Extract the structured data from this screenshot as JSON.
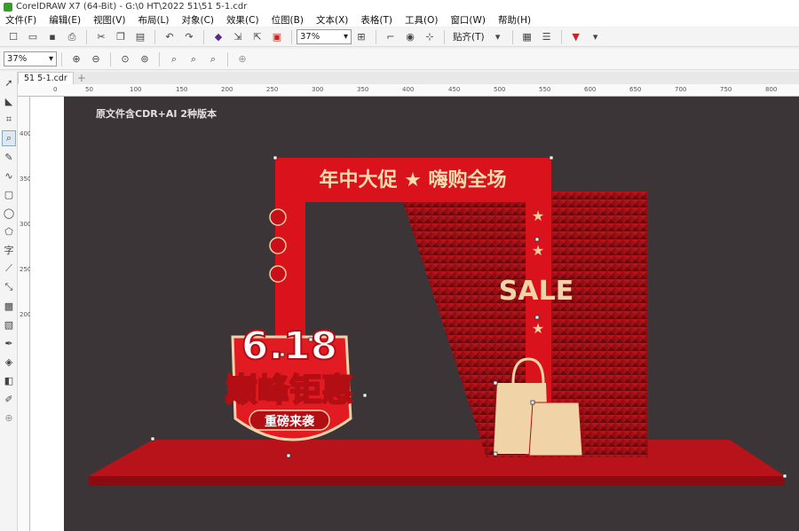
{
  "window": {
    "title": "CorelDRAW X7 (64-Bit) - G:\\0 HT\\2022 51\\51 5-1.cdr"
  },
  "menu": [
    "文件(F)",
    "编辑(E)",
    "视图(V)",
    "布局(L)",
    "对象(C)",
    "效果(C)",
    "位图(B)",
    "文本(X)",
    "表格(T)",
    "工具(O)",
    "窗口(W)",
    "帮助(H)"
  ],
  "toolbar": {
    "zoom_value": "37%",
    "snap_label": "贴齐(T)"
  },
  "propbar": {
    "zoom_value": "37%"
  },
  "tabs": [
    {
      "label": "51 5-1.cdr"
    }
  ],
  "ruler": {
    "h_ticks": [
      "0",
      "50",
      "100",
      "150",
      "200",
      "250",
      "300",
      "350",
      "400",
      "450",
      "500",
      "550",
      "600",
      "650",
      "700",
      "750",
      "800"
    ],
    "v_ticks": [
      "400",
      "350",
      "300",
      "250",
      "200"
    ]
  },
  "canvas": {
    "note": "原文件含CDR+AI 2种版本",
    "arch_banner": "年中大促 ★ 嗨购全场",
    "sale_text": "SALE",
    "badge_number": "6.18",
    "badge_main": "巅峰钜惠",
    "badge_sub": "重磅来袭"
  },
  "colors": {
    "page_bg": "#3c3537",
    "red": "#d9121b",
    "dark_red": "#9b0f15",
    "cream": "#f0d4a8"
  }
}
